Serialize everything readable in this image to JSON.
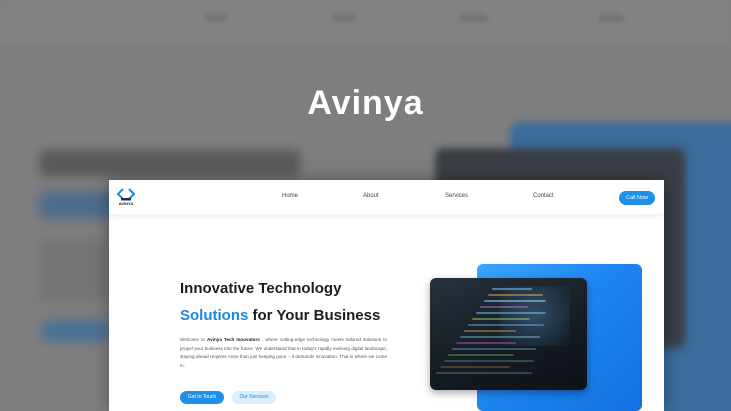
{
  "overlay_title": "Avinya",
  "site": {
    "logo_text": "AVINYA",
    "nav": {
      "items": [
        "Home",
        "About",
        "Services",
        "Contact"
      ],
      "cta_label": "Call Now"
    },
    "hero": {
      "title_line1": "Innovative Technology",
      "title_line2_accent": "Solutions",
      "title_line2_rest": " for Your Business",
      "desc_prefix": "Welcome to ",
      "desc_company": "Avinya Tech Innovators",
      "desc_suffix": " , where cutting-edge technology meets tailored solutions to propel your business into the future. We understand that in today's rapidly evolving digital landscape, staying ahead requires more than just keeping pace – it demands innovation. That is where we come in.",
      "primary_button": "Get In Touch",
      "secondary_button": "Our Services"
    }
  },
  "colors": {
    "accent": "#1e88e0",
    "button": "#1e90ea",
    "secondary_button_bg": "#dbeefd"
  },
  "icons": {
    "logo": "chevron-brackets-logo-icon",
    "hero_image": "code-on-laptop-image"
  }
}
